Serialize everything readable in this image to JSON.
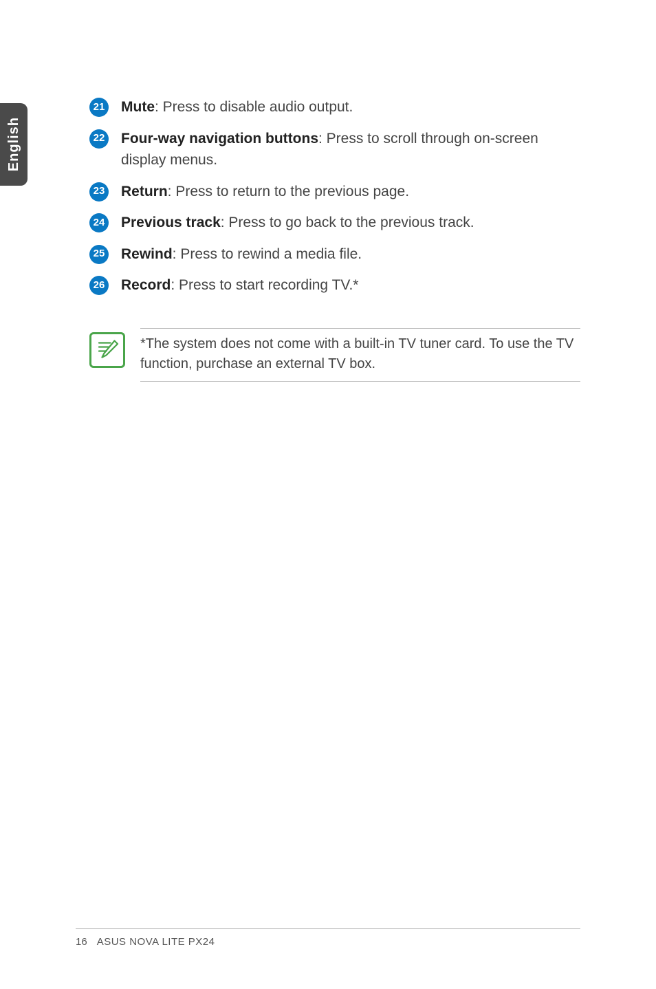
{
  "sideTab": "English",
  "items": [
    {
      "num": "21",
      "label": "Mute",
      "desc": ": Press to disable audio output."
    },
    {
      "num": "22",
      "label": "Four-way navigation buttons",
      "desc": ": Press to scroll through on-screen display menus."
    },
    {
      "num": "23",
      "label": "Return",
      "desc": ": Press to return to the previous page."
    },
    {
      "num": "24",
      "label": "Previous track",
      "desc": ": Press to go back to the previous track."
    },
    {
      "num": "25",
      "label": "Rewind",
      "desc": ": Press to rewind a media file."
    },
    {
      "num": "26",
      "label": "Record",
      "desc": ": Press to start recording TV.*"
    }
  ],
  "note": "*The system does not come with a built-in TV tuner card. To use the TV function, purchase an external TV box.",
  "footer": {
    "page": "16",
    "model": "ASUS NOVA LITE PX24"
  }
}
